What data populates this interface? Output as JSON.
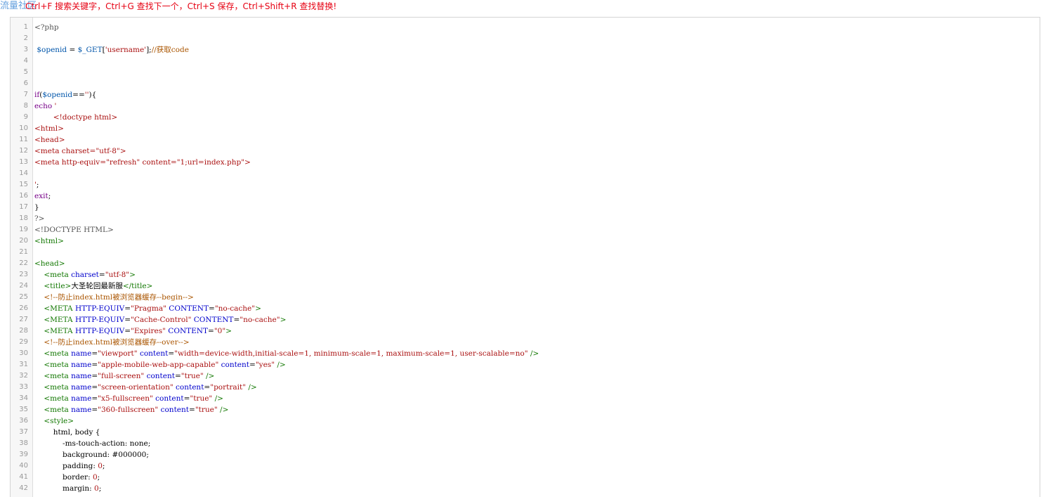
{
  "watermark": "流量社区",
  "hint_text": "Ctrl+F 搜索关键字，Ctrl+G 查找下一个，Ctrl+S 保存，Ctrl+Shift+R 查找替换!",
  "lines": [
    {
      "n": "1",
      "tokens": [
        [
          "meta",
          "<?php"
        ]
      ]
    },
    {
      "n": "2",
      "tokens": []
    },
    {
      "n": "3",
      "tokens": [
        [
          "txt",
          " "
        ],
        [
          "var",
          "$openid"
        ],
        [
          "txt",
          " = "
        ],
        [
          "var",
          "$_GET"
        ],
        [
          "txt",
          "["
        ],
        [
          "str",
          "'username'"
        ],
        [
          "txt",
          "];"
        ],
        [
          "cmt",
          "//获取code"
        ]
      ]
    },
    {
      "n": "4",
      "tokens": []
    },
    {
      "n": "5",
      "tokens": []
    },
    {
      "n": "6",
      "tokens": []
    },
    {
      "n": "7",
      "tokens": [
        [
          "kw",
          "if"
        ],
        [
          "txt",
          "("
        ],
        [
          "var",
          "$openid"
        ],
        [
          "txt",
          "=="
        ],
        [
          "str",
          "''"
        ],
        [
          "txt",
          "){"
        ]
      ]
    },
    {
      "n": "8",
      "tokens": [
        [
          "kw",
          "echo"
        ],
        [
          "txt",
          " "
        ],
        [
          "str",
          "'"
        ]
      ]
    },
    {
      "n": "9",
      "tokens": [
        [
          "str",
          "        <!doctype html>"
        ]
      ]
    },
    {
      "n": "10",
      "tokens": [
        [
          "str",
          "<html>"
        ]
      ]
    },
    {
      "n": "11",
      "tokens": [
        [
          "str",
          "<head>"
        ]
      ]
    },
    {
      "n": "12",
      "tokens": [
        [
          "str",
          "<meta charset=\"utf-8\">"
        ]
      ]
    },
    {
      "n": "13",
      "tokens": [
        [
          "str",
          "<meta http-equiv=\"refresh\" content=\"1;url=index.php\">"
        ]
      ]
    },
    {
      "n": "14",
      "tokens": []
    },
    {
      "n": "15",
      "tokens": [
        [
          "str",
          "'"
        ],
        [
          "txt",
          ";"
        ]
      ]
    },
    {
      "n": "16",
      "tokens": [
        [
          "kw",
          "exit"
        ],
        [
          "txt",
          ";"
        ]
      ]
    },
    {
      "n": "17",
      "tokens": [
        [
          "txt",
          "}"
        ]
      ]
    },
    {
      "n": "18",
      "tokens": [
        [
          "meta",
          "?>"
        ]
      ]
    },
    {
      "n": "19",
      "tokens": [
        [
          "meta",
          "<!DOCTYPE HTML>"
        ]
      ]
    },
    {
      "n": "20",
      "tokens": [
        [
          "tag",
          "<html>"
        ]
      ]
    },
    {
      "n": "21",
      "tokens": []
    },
    {
      "n": "22",
      "tokens": [
        [
          "tag",
          "<head>"
        ]
      ]
    },
    {
      "n": "23",
      "tokens": [
        [
          "txt",
          "    "
        ],
        [
          "tag",
          "<meta"
        ],
        [
          "txt",
          " "
        ],
        [
          "attr",
          "charset"
        ],
        [
          "txt",
          "="
        ],
        [
          "str",
          "\"utf-8\""
        ],
        [
          "tag",
          ">"
        ]
      ]
    },
    {
      "n": "24",
      "tokens": [
        [
          "txt",
          "    "
        ],
        [
          "tag",
          "<title>"
        ],
        [
          "cn",
          "大圣轮回最新服"
        ],
        [
          "tag",
          "</title>"
        ]
      ]
    },
    {
      "n": "25",
      "tokens": [
        [
          "txt",
          "    "
        ],
        [
          "cmt",
          "<!--防止index.html被浏览器缓存--begin-->"
        ]
      ]
    },
    {
      "n": "26",
      "tokens": [
        [
          "txt",
          "    "
        ],
        [
          "tag",
          "<META"
        ],
        [
          "txt",
          " "
        ],
        [
          "attr",
          "HTTP-EQUIV"
        ],
        [
          "txt",
          "="
        ],
        [
          "str",
          "\"Pragma\""
        ],
        [
          "txt",
          " "
        ],
        [
          "attr",
          "CONTENT"
        ],
        [
          "txt",
          "="
        ],
        [
          "str",
          "\"no-cache\""
        ],
        [
          "tag",
          ">"
        ]
      ]
    },
    {
      "n": "27",
      "tokens": [
        [
          "txt",
          "    "
        ],
        [
          "tag",
          "<META"
        ],
        [
          "txt",
          " "
        ],
        [
          "attr",
          "HTTP-EQUIV"
        ],
        [
          "txt",
          "="
        ],
        [
          "str",
          "\"Cache-Control\""
        ],
        [
          "txt",
          " "
        ],
        [
          "attr",
          "CONTENT"
        ],
        [
          "txt",
          "="
        ],
        [
          "str",
          "\"no-cache\""
        ],
        [
          "tag",
          ">"
        ]
      ]
    },
    {
      "n": "28",
      "tokens": [
        [
          "txt",
          "    "
        ],
        [
          "tag",
          "<META"
        ],
        [
          "txt",
          " "
        ],
        [
          "attr",
          "HTTP-EQUIV"
        ],
        [
          "txt",
          "="
        ],
        [
          "str",
          "\"Expires\""
        ],
        [
          "txt",
          " "
        ],
        [
          "attr",
          "CONTENT"
        ],
        [
          "txt",
          "="
        ],
        [
          "str",
          "\"0\""
        ],
        [
          "tag",
          ">"
        ]
      ]
    },
    {
      "n": "29",
      "tokens": [
        [
          "txt",
          "    "
        ],
        [
          "cmt",
          "<!--防止index.html被浏览器缓存--over-->"
        ]
      ]
    },
    {
      "n": "30",
      "tokens": [
        [
          "txt",
          "    "
        ],
        [
          "tag",
          "<meta"
        ],
        [
          "txt",
          " "
        ],
        [
          "attr",
          "name"
        ],
        [
          "txt",
          "="
        ],
        [
          "str",
          "\"viewport\""
        ],
        [
          "txt",
          " "
        ],
        [
          "attr",
          "content"
        ],
        [
          "txt",
          "="
        ],
        [
          "str",
          "\"width=device-width,initial-scale=1, minimum-scale=1, maximum-scale=1, user-scalable=no\""
        ],
        [
          "txt",
          " "
        ],
        [
          "tag",
          "/>"
        ]
      ]
    },
    {
      "n": "31",
      "tokens": [
        [
          "txt",
          "    "
        ],
        [
          "tag",
          "<meta"
        ],
        [
          "txt",
          " "
        ],
        [
          "attr",
          "name"
        ],
        [
          "txt",
          "="
        ],
        [
          "str",
          "\"apple-mobile-web-app-capable\""
        ],
        [
          "txt",
          " "
        ],
        [
          "attr",
          "content"
        ],
        [
          "txt",
          "="
        ],
        [
          "str",
          "\"yes\""
        ],
        [
          "txt",
          " "
        ],
        [
          "tag",
          "/>"
        ]
      ]
    },
    {
      "n": "32",
      "tokens": [
        [
          "txt",
          "    "
        ],
        [
          "tag",
          "<meta"
        ],
        [
          "txt",
          " "
        ],
        [
          "attr",
          "name"
        ],
        [
          "txt",
          "="
        ],
        [
          "str",
          "\"full-screen\""
        ],
        [
          "txt",
          " "
        ],
        [
          "attr",
          "content"
        ],
        [
          "txt",
          "="
        ],
        [
          "str",
          "\"true\""
        ],
        [
          "txt",
          " "
        ],
        [
          "tag",
          "/>"
        ]
      ]
    },
    {
      "n": "33",
      "tokens": [
        [
          "txt",
          "    "
        ],
        [
          "tag",
          "<meta"
        ],
        [
          "txt",
          " "
        ],
        [
          "attr",
          "name"
        ],
        [
          "txt",
          "="
        ],
        [
          "str",
          "\"screen-orientation\""
        ],
        [
          "txt",
          " "
        ],
        [
          "attr",
          "content"
        ],
        [
          "txt",
          "="
        ],
        [
          "str",
          "\"portrait\""
        ],
        [
          "txt",
          " "
        ],
        [
          "tag",
          "/>"
        ]
      ]
    },
    {
      "n": "34",
      "tokens": [
        [
          "txt",
          "    "
        ],
        [
          "tag",
          "<meta"
        ],
        [
          "txt",
          " "
        ],
        [
          "attr",
          "name"
        ],
        [
          "txt",
          "="
        ],
        [
          "str",
          "\"x5-fullscreen\""
        ],
        [
          "txt",
          " "
        ],
        [
          "attr",
          "content"
        ],
        [
          "txt",
          "="
        ],
        [
          "str",
          "\"true\""
        ],
        [
          "txt",
          " "
        ],
        [
          "tag",
          "/>"
        ]
      ]
    },
    {
      "n": "35",
      "tokens": [
        [
          "txt",
          "    "
        ],
        [
          "tag",
          "<meta"
        ],
        [
          "txt",
          " "
        ],
        [
          "attr",
          "name"
        ],
        [
          "txt",
          "="
        ],
        [
          "str",
          "\"360-fullscreen\""
        ],
        [
          "txt",
          " "
        ],
        [
          "attr",
          "content"
        ],
        [
          "txt",
          "="
        ],
        [
          "str",
          "\"true\""
        ],
        [
          "txt",
          " "
        ],
        [
          "tag",
          "/>"
        ]
      ]
    },
    {
      "n": "36",
      "tokens": [
        [
          "txt",
          "    "
        ],
        [
          "tag",
          "<style>"
        ]
      ]
    },
    {
      "n": "37",
      "tokens": [
        [
          "txt",
          "        html, body {"
        ]
      ]
    },
    {
      "n": "38",
      "tokens": [
        [
          "txt",
          "            -ms-touch-action: none;"
        ]
      ]
    },
    {
      "n": "39",
      "tokens": [
        [
          "txt",
          "            background: #000000;"
        ]
      ]
    },
    {
      "n": "40",
      "tokens": [
        [
          "txt",
          "            padding: "
        ],
        [
          "str",
          "0"
        ],
        [
          "txt",
          ";"
        ]
      ]
    },
    {
      "n": "41",
      "tokens": [
        [
          "txt",
          "            border: "
        ],
        [
          "str",
          "0"
        ],
        [
          "txt",
          ";"
        ]
      ]
    },
    {
      "n": "42",
      "tokens": [
        [
          "txt",
          "            margin: "
        ],
        [
          "str",
          "0"
        ],
        [
          "txt",
          ";"
        ]
      ]
    }
  ]
}
